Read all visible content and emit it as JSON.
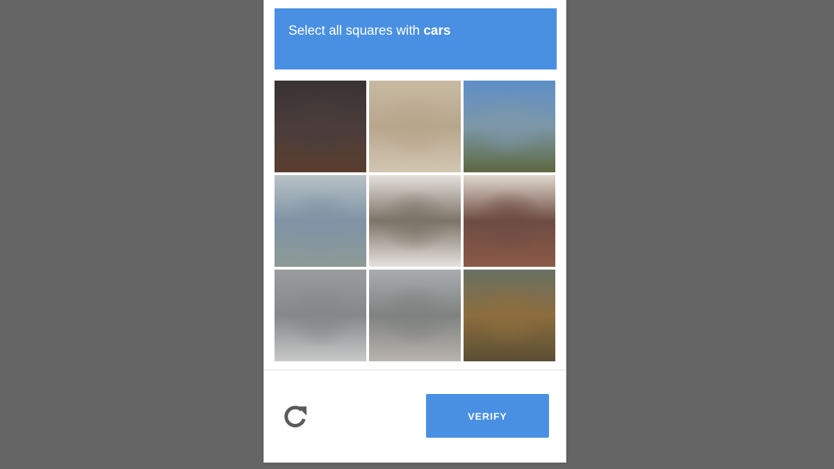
{
  "prompt": {
    "lead": "Select all squares with ",
    "target": "cars"
  },
  "tiles": [
    {
      "name": "tile-1",
      "colors": [
        "#3a3233",
        "#4a3d3c",
        "#5a3e2e"
      ]
    },
    {
      "name": "tile-2",
      "colors": [
        "#c8baa3",
        "#b7a68c",
        "#d2c6b2"
      ]
    },
    {
      "name": "tile-3",
      "colors": [
        "#5e8fc8",
        "#7c97a8",
        "#5d6840"
      ]
    },
    {
      "name": "tile-4",
      "colors": [
        "#b8c2c6",
        "#7f93a5",
        "#8d9a96"
      ]
    },
    {
      "name": "tile-5",
      "colors": [
        "#e4e0db",
        "#7d7468",
        "#e6e2dd"
      ]
    },
    {
      "name": "tile-6",
      "colors": [
        "#e0d8ce",
        "#6e4c43",
        "#8a5a46"
      ]
    },
    {
      "name": "tile-7",
      "colors": [
        "#9a9c9d",
        "#858789",
        "#c8c8c8"
      ]
    },
    {
      "name": "tile-8",
      "colors": [
        "#a9acaf",
        "#7f8280",
        "#b8b3ae"
      ]
    },
    {
      "name": "tile-9",
      "colors": [
        "#687063",
        "#8c6d3e",
        "#5a4e33"
      ]
    }
  ],
  "buttons": {
    "verify_label": "VERIFY"
  },
  "icons": {
    "reload": "reload-icon"
  },
  "colors": {
    "accent": "#4a90e2",
    "backdrop": "#656565",
    "icon": "#5b5b5b"
  }
}
